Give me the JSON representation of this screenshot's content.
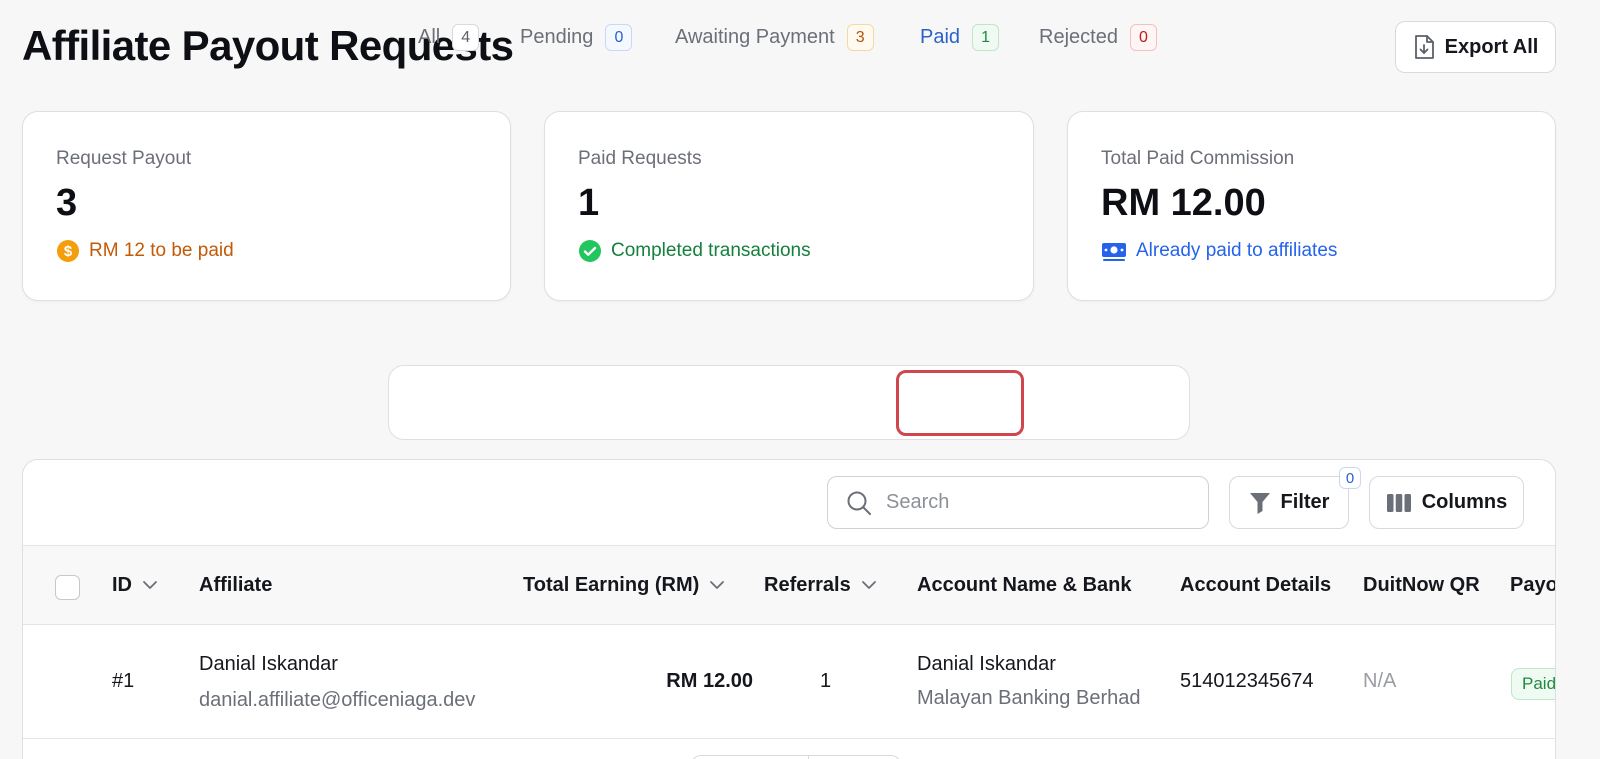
{
  "page": {
    "title": "Affiliate Payout Requests",
    "export_label": "Export All"
  },
  "stats": [
    {
      "label": "Request Payout",
      "value": "3",
      "sub": "RM 12 to be paid",
      "icon": "dollar-coin-icon",
      "color": "#c25a07",
      "icon_color": "#f59e0b"
    },
    {
      "label": "Paid Requests",
      "value": "1",
      "sub": "Completed transactions",
      "icon": "check-circle-icon",
      "color": "#15803d",
      "icon_color": "#22c55e"
    },
    {
      "label": "Total Paid Commission",
      "value": "RM 12.00",
      "sub": "Already paid to affiliates",
      "icon": "banknote-icon",
      "color": "#2563eb",
      "icon_color": "#2563eb"
    }
  ],
  "tabs": [
    {
      "label": "All",
      "count": "4",
      "badge_color": "#6b6f78",
      "badge_border": "#d9dadd",
      "badge_bg": "#ffffff"
    },
    {
      "label": "Pending",
      "count": "0",
      "badge_color": "#2a62c9",
      "badge_border": "#c9d8f3",
      "badge_bg": "#f4f8ff"
    },
    {
      "label": "Awaiting Payment",
      "count": "3",
      "badge_color": "#b45309",
      "badge_border": "#f3d9a6",
      "badge_bg": "#fffaf0"
    },
    {
      "label": "Paid",
      "count": "1",
      "badge_color": "#1f8a3d",
      "badge_border": "#bfe6c9",
      "badge_bg": "#effaf2",
      "active": true
    },
    {
      "label": "Rejected",
      "count": "0",
      "badge_color": "#b91c1c",
      "badge_border": "#f2c2c2",
      "badge_bg": "#fff5f5"
    }
  ],
  "toolbar": {
    "search_placeholder": "Search",
    "filter_label": "Filter",
    "filter_count": "0",
    "columns_label": "Columns"
  },
  "table": {
    "columns": [
      "ID",
      "Affiliate",
      "Total Earning (RM)",
      "Referrals",
      "Account Name & Bank",
      "Account Details",
      "DuitNow QR",
      "Payo"
    ],
    "rows": [
      {
        "id": "#1",
        "affiliate_name": "Danial Iskandar",
        "affiliate_email": "danial.affiliate@officeniaga.dev",
        "total_earning": "RM 12.00",
        "referrals": "1",
        "account_name": "Danial Iskandar",
        "bank": "Malayan Banking Berhad",
        "account_details": "514012345674",
        "duitnow_qr": "N/A",
        "payout_status": "Paid"
      }
    ]
  },
  "colors": {
    "active_tab_text": "#2a62c9",
    "active_tab_outline": "#d0464d"
  }
}
